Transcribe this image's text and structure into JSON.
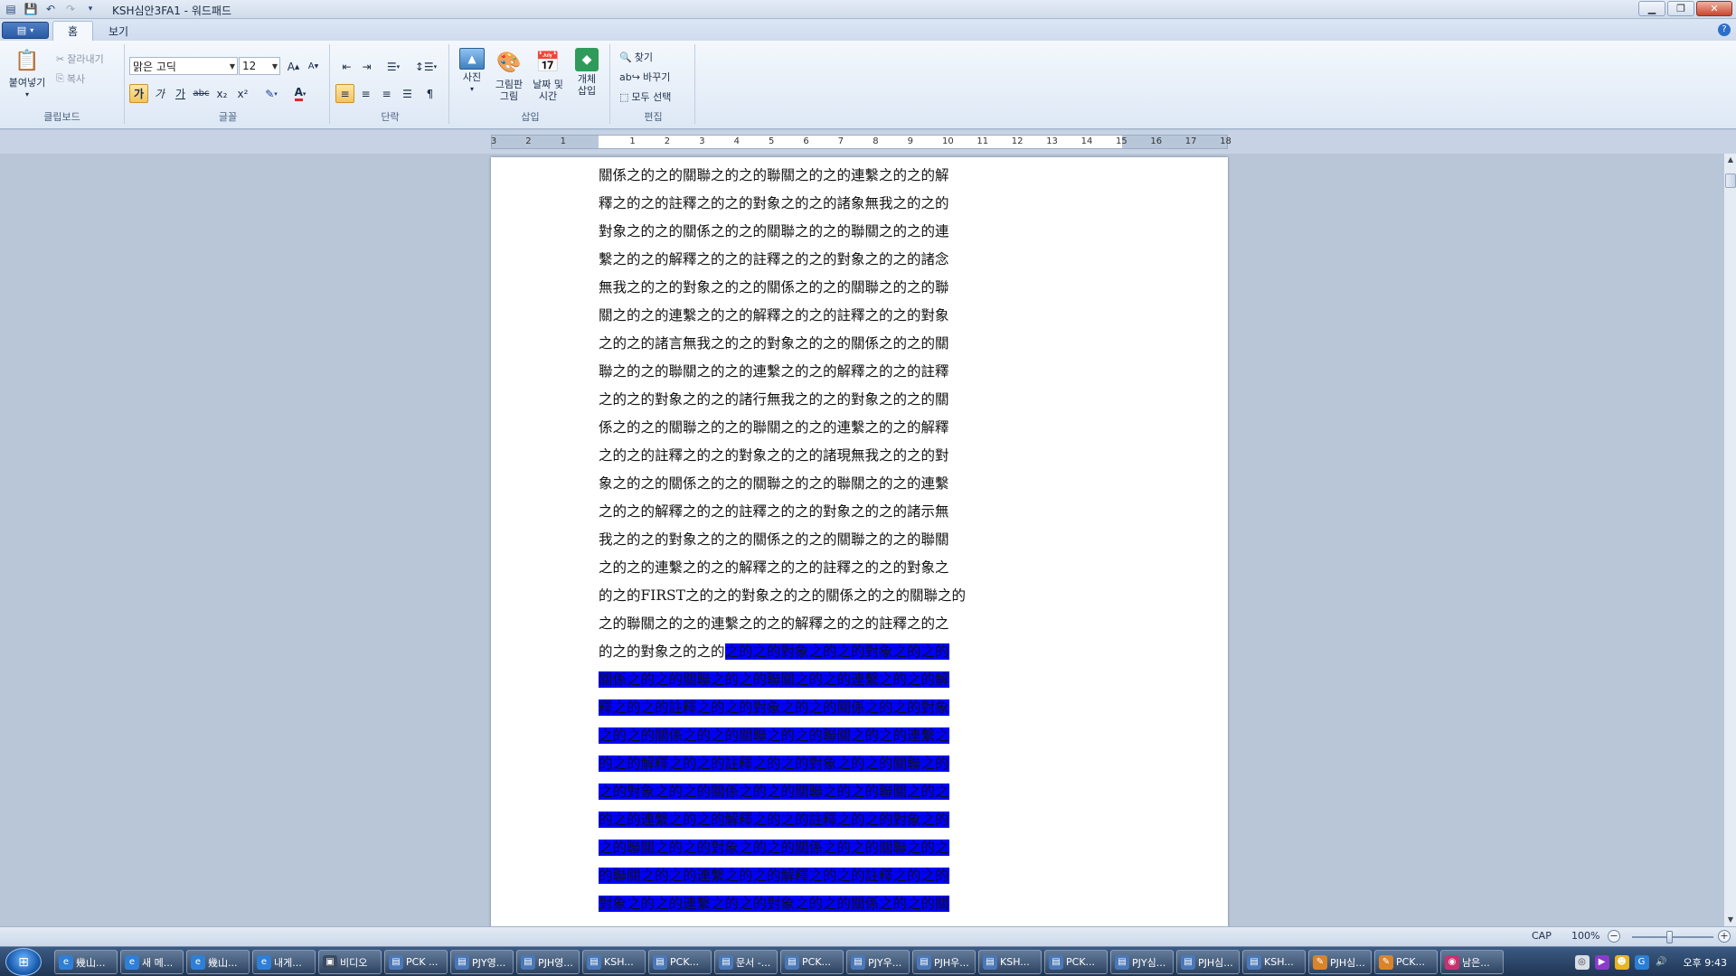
{
  "window": {
    "title": "KSH심안3FA1 - 워드패드",
    "controls": [
      "minimize",
      "restore",
      "close"
    ]
  },
  "ribbon": {
    "tabs": [
      {
        "label": "홈",
        "active": true
      },
      {
        "label": "보기",
        "active": false
      }
    ],
    "clipboard": {
      "label": "클립보드",
      "paste": "붙여넣기",
      "cut": "잘라내기",
      "copy": "복사"
    },
    "font": {
      "label": "글꼴",
      "family": "맑은 고딕",
      "size": "12",
      "bold_glyph": "가",
      "italic_glyph": "가",
      "underline_glyph": "가",
      "strike_glyph": "abc",
      "sub_glyph": "x₂",
      "sup_glyph": "x²"
    },
    "paragraph": {
      "label": "단락"
    },
    "insert": {
      "label": "삽입",
      "picture": "사진",
      "paint_l1": "그림판",
      "paint_l2": "그림",
      "datetime_l1": "날짜 및",
      "datetime_l2": "시간",
      "object_l1": "개체",
      "object_l2": "삽입"
    },
    "editing": {
      "label": "편집",
      "find": "찾기",
      "replace": "바꾸기",
      "select_all": "모두 선택"
    }
  },
  "ruler": {
    "ticks": [
      "3",
      "2",
      "1",
      "1",
      "2",
      "3",
      "4",
      "5",
      "6",
      "7",
      "8",
      "9",
      "10",
      "11",
      "12",
      "13",
      "14",
      "15",
      "16",
      "17",
      "18"
    ]
  },
  "document": {
    "lines": [
      {
        "plain": "關係之的之的關聯之的之的聯關之的之的連繫之的之的解",
        "selected": ""
      },
      {
        "plain": "釋之的之的註釋之的之的對象之的之的諸象無我之的之的",
        "selected": ""
      },
      {
        "plain": "對象之的之的關係之的之的關聯之的之的聯關之的之的連",
        "selected": ""
      },
      {
        "plain": "繫之的之的解釋之的之的註釋之的之的對象之的之的諸念",
        "selected": ""
      },
      {
        "plain": "無我之的之的對象之的之的關係之的之的關聯之的之的聯",
        "selected": ""
      },
      {
        "plain": "關之的之的連繫之的之的解釋之的之的註釋之的之的對象",
        "selected": ""
      },
      {
        "plain": "之的之的諸言無我之的之的對象之的之的關係之的之的關",
        "selected": ""
      },
      {
        "plain": "聯之的之的聯關之的之的連繫之的之的解釋之的之的註釋",
        "selected": ""
      },
      {
        "plain": "之的之的對象之的之的諸行無我之的之的對象之的之的關",
        "selected": ""
      },
      {
        "plain": "係之的之的關聯之的之的聯關之的之的連繫之的之的解釋",
        "selected": ""
      },
      {
        "plain": "之的之的註釋之的之的對象之的之的諸現無我之的之的對",
        "selected": ""
      },
      {
        "plain": "象之的之的關係之的之的關聯之的之的聯關之的之的連繫",
        "selected": ""
      },
      {
        "plain": "之的之的解釋之的之的註釋之的之的對象之的之的諸示無",
        "selected": ""
      },
      {
        "plain": "我之的之的對象之的之的關係之的之的關聯之的之的聯關",
        "selected": ""
      },
      {
        "plain": "之的之的連繫之的之的解釋之的之的註釋之的之的對象之",
        "selected": ""
      },
      {
        "plain": "的之的FIRST之的之的對象之的之的關係之的之的關聯之的",
        "selected": ""
      },
      {
        "plain": "之的聯關之的之的連繫之的之的解釋之的之的註釋之的之",
        "selected": ""
      },
      {
        "plain": "的之的對象之的之的",
        "selected": "之的之的對象之的之的對象之的之的"
      },
      {
        "plain": "",
        "selected": "關係之的之的關聯之的之的聯關之的之的連繫之的之的解"
      },
      {
        "plain": "",
        "selected": "釋之的之的註釋之的之的對象之的之的關係之的之的對象"
      },
      {
        "plain": "",
        "selected": "之的之的關係之的之的關聯之的之的聯關之的之的連繫之"
      },
      {
        "plain": "",
        "selected": "的之的解釋之的之的註釋之的之的對象之的之的關聯之的"
      },
      {
        "plain": "",
        "selected": "之的對象之的之的關係之的之的關聯之的之的聯關之的之"
      },
      {
        "plain": "",
        "selected": "的之的連繫之的之的解釋之的之的註釋之的之的對象之的"
      },
      {
        "plain": "",
        "selected": "之的聯關之的之的對象之的之的關係之的之的關聯之的之"
      },
      {
        "plain": "",
        "selected": "的聯關之的之的連繫之的之的解釋之的之的註釋之的之的"
      },
      {
        "plain": "",
        "selected": "對象之的之的連繫之的之的對象之的之的關係之的之的關"
      }
    ],
    "selection_color": "#0000ff"
  },
  "status": {
    "caps": "CAP",
    "zoom": "100%"
  },
  "taskbar": {
    "items": [
      {
        "label": "幾山...",
        "icon": "ie-icon"
      },
      {
        "label": "새 메...",
        "icon": "ie-icon"
      },
      {
        "label": "幾山...",
        "icon": "ie-icon"
      },
      {
        "label": "내게...",
        "icon": "ie-icon"
      },
      {
        "label": "비디오",
        "icon": "video-icon"
      },
      {
        "label": "PCK ...",
        "icon": "wordpad-icon"
      },
      {
        "label": "PJY영...",
        "icon": "wordpad-icon"
      },
      {
        "label": "PJH영...",
        "icon": "wordpad-icon"
      },
      {
        "label": "KSH...",
        "icon": "wordpad-icon"
      },
      {
        "label": "PCK...",
        "icon": "wordpad-icon"
      },
      {
        "label": "문서 -...",
        "icon": "wordpad-icon"
      },
      {
        "label": "PCK...",
        "icon": "wordpad-icon"
      },
      {
        "label": "PJY우...",
        "icon": "wordpad-icon"
      },
      {
        "label": "PJH우...",
        "icon": "wordpad-icon"
      },
      {
        "label": "KSH...",
        "icon": "wordpad-icon"
      },
      {
        "label": "PCK...",
        "icon": "wordpad-icon"
      },
      {
        "label": "PJY심...",
        "icon": "wordpad-icon"
      },
      {
        "label": "PJH심...",
        "icon": "wordpad-icon"
      },
      {
        "label": "KSH...",
        "icon": "wordpad-icon"
      },
      {
        "label": "PJH심...",
        "icon": "paint-icon"
      },
      {
        "label": "PCK...",
        "icon": "paint-icon"
      },
      {
        "label": "남은...",
        "icon": "app-icon"
      }
    ],
    "clock": "오후 9:43"
  }
}
